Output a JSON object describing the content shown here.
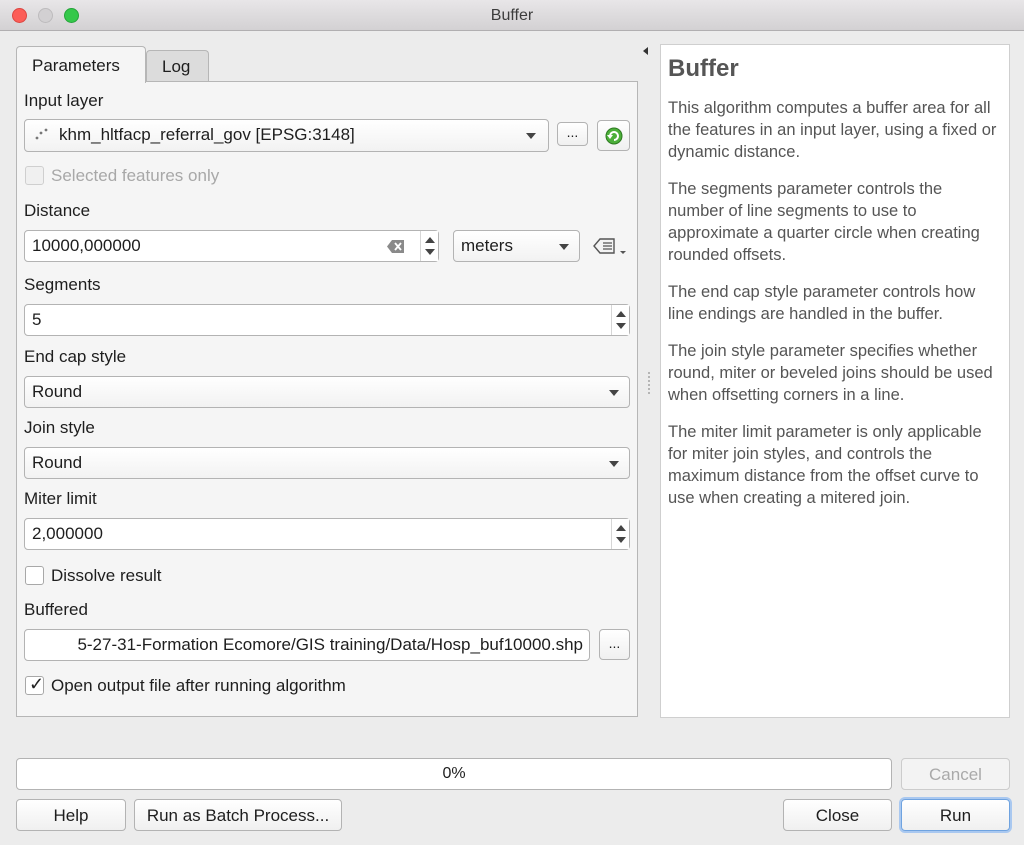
{
  "window": {
    "title": "Buffer"
  },
  "tabs": [
    {
      "label": "Parameters"
    },
    {
      "label": "Log"
    }
  ],
  "params": {
    "input_layer": {
      "label": "Input layer",
      "value": "khm_hltfacp_referral_gov [EPSG:3148]",
      "browse": "..."
    },
    "selected_only": {
      "label": "Selected features only",
      "checked": false
    },
    "distance": {
      "label": "Distance",
      "value": "10000,000000",
      "unit": "meters"
    },
    "segments": {
      "label": "Segments",
      "value": "5"
    },
    "end_cap": {
      "label": "End cap style",
      "value": "Round"
    },
    "join_style": {
      "label": "Join style",
      "value": "Round"
    },
    "miter": {
      "label": "Miter limit",
      "value": "2,000000"
    },
    "dissolve": {
      "label": "Dissolve result",
      "checked": false
    },
    "buffered": {
      "label": "Buffered",
      "value": "5-27-31-Formation Ecomore/GIS training/Data/Hosp_buf10000.shp",
      "browse": "..."
    },
    "open_output": {
      "label": "Open output file after running algorithm",
      "checked": true,
      "mark": "✓"
    }
  },
  "help": {
    "title": "Buffer",
    "paragraphs": [
      "This algorithm computes a buffer area for all the features in an input layer, using a fixed or dynamic distance.",
      "The segments parameter controls the number of line segments to use to approximate a quarter circle when creating rounded offsets.",
      "The end cap style parameter controls how line endings are handled in the buffer.",
      "The join style parameter specifies whether round, miter or beveled joins should be used when offsetting corners in a line.",
      "The miter limit parameter is only applicable for miter join styles, and controls the maximum distance from the offset curve to use when creating a mitered join."
    ]
  },
  "progress": {
    "label": "0%",
    "value": 0
  },
  "buttons": {
    "cancel": "Cancel",
    "help": "Help",
    "batch": "Run as Batch Process...",
    "close": "Close",
    "run": "Run"
  },
  "icons": {
    "refresh": "refresh-icon",
    "clear": "clear-icon",
    "data_defined": "data-defined-override-icon",
    "point_layer": "point-layer-icon",
    "collapse": "collapse-arrow-icon"
  },
  "colors": {
    "run_border": "#6fa3e0",
    "refresh_green": "#3a9a2b",
    "close_red": "#fc5d57",
    "max_green": "#34c84a"
  }
}
